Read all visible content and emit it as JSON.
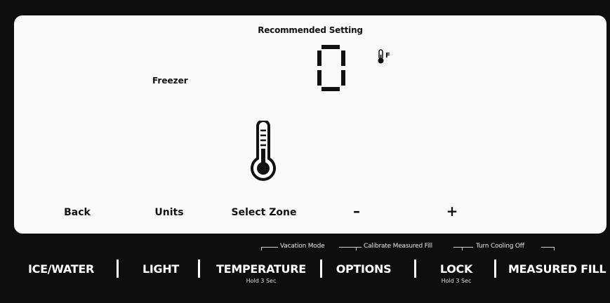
{
  "display": {
    "recommended_label": "Recommended Setting",
    "zone_label": "Freezer",
    "temperature_value": "0",
    "unit": "F"
  },
  "softkeys": {
    "back": "Back",
    "units": "Units",
    "select_zone": "Select Zone",
    "minus": "–",
    "plus": "+"
  },
  "hold_labels": {
    "vacation_mode": "Vacation Mode",
    "calibrate_measured_fill": "Calibrate Measured Fill",
    "turn_cooling_off": "Turn Cooling Off"
  },
  "buttons": {
    "ice_water": "ICE/WATER",
    "light": "LIGHT",
    "temperature": "TEMPERATURE",
    "temperature_sub": "Hold 3 Sec",
    "options": "OPTIONS",
    "lock": "LOCK",
    "lock_sub": "Hold 3 Sec",
    "measured_fill": "MEASURED FILL"
  },
  "icons": {
    "small_thermometer": "thermometer-icon",
    "large_thermometer": "thermometer-icon"
  },
  "colors": {
    "panel_background": "#0e0e0e",
    "screen_background": "#fafafa",
    "text_on_screen": "#111111",
    "text_on_panel": "#ffffff"
  }
}
